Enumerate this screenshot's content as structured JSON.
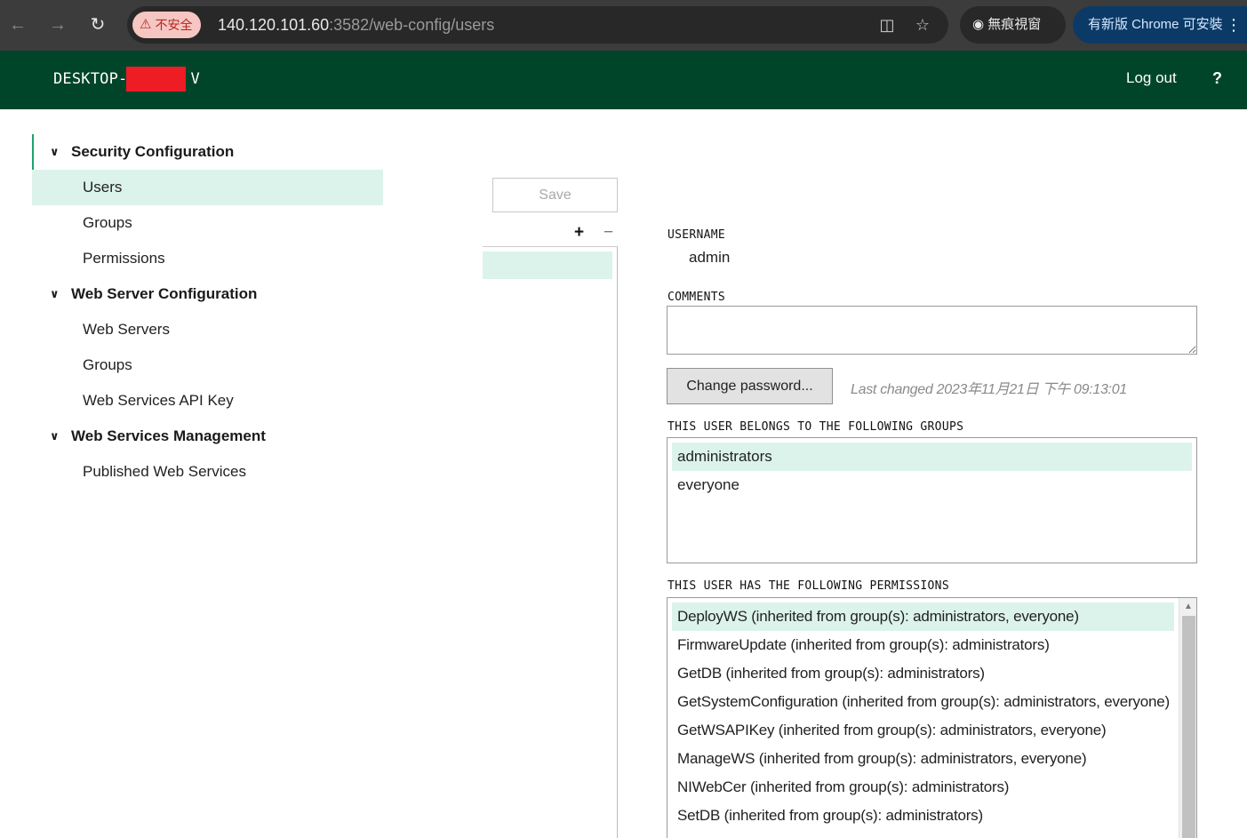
{
  "browser": {
    "security_label": "不安全",
    "url_host": "140.120.101.60",
    "url_path": ":3582/web-config/users",
    "incognito_label": "無痕視窗",
    "update_label": "有新版 Chrome 可安裝",
    "icons": [
      "back-icon",
      "forward-icon",
      "reload-icon",
      "translate-icon",
      "star-icon",
      "incognito-icon",
      "more-icon"
    ]
  },
  "header": {
    "host_prefix": "DESKTOP-",
    "host_suffix": "V",
    "logout_label": "Log out",
    "help_label": "?"
  },
  "sidebar": {
    "sections": [
      {
        "label": "Security Configuration",
        "items": [
          "Users",
          "Groups",
          "Permissions"
        ]
      },
      {
        "label": "Web Server Configuration",
        "items": [
          "Web Servers",
          "Groups",
          "Web Services API Key"
        ]
      },
      {
        "label": "Web Services Management",
        "items": [
          "Published Web Services"
        ]
      }
    ],
    "selected": "Users"
  },
  "toolbar": {
    "save_label": "Save",
    "add_label": "+",
    "remove_label": "−"
  },
  "detail": {
    "username_label": "USERNAME",
    "username_value": "admin",
    "comments_label": "COMMENTS",
    "comments_value": "",
    "change_password_label": "Change password...",
    "last_changed": "Last changed 2023年11月21日 下午 09:13:01",
    "groups_label": "THIS USER BELONGS TO THE FOLLOWING GROUPS",
    "groups": [
      "administrators",
      "everyone"
    ],
    "permissions_label": "THIS USER HAS THE FOLLOWING PERMISSIONS",
    "permissions": [
      "DeployWS (inherited from group(s): administrators, everyone)",
      "FirmwareUpdate (inherited from group(s): administrators)",
      "GetDB (inherited from group(s): administrators)",
      "GetSystemConfiguration (inherited from group(s): administrators, everyone)",
      "GetWSAPIKey (inherited from group(s): administrators, everyone)",
      "ManageWS (inherited from group(s): administrators, everyone)",
      "NIWebCer (inherited from group(s): administrators)",
      "SetDB (inherited from group(s): administrators)"
    ]
  },
  "colors": {
    "header_bg": "#00452a",
    "selection_bg": "#dcf3ec",
    "accent": "#1fa36b"
  }
}
